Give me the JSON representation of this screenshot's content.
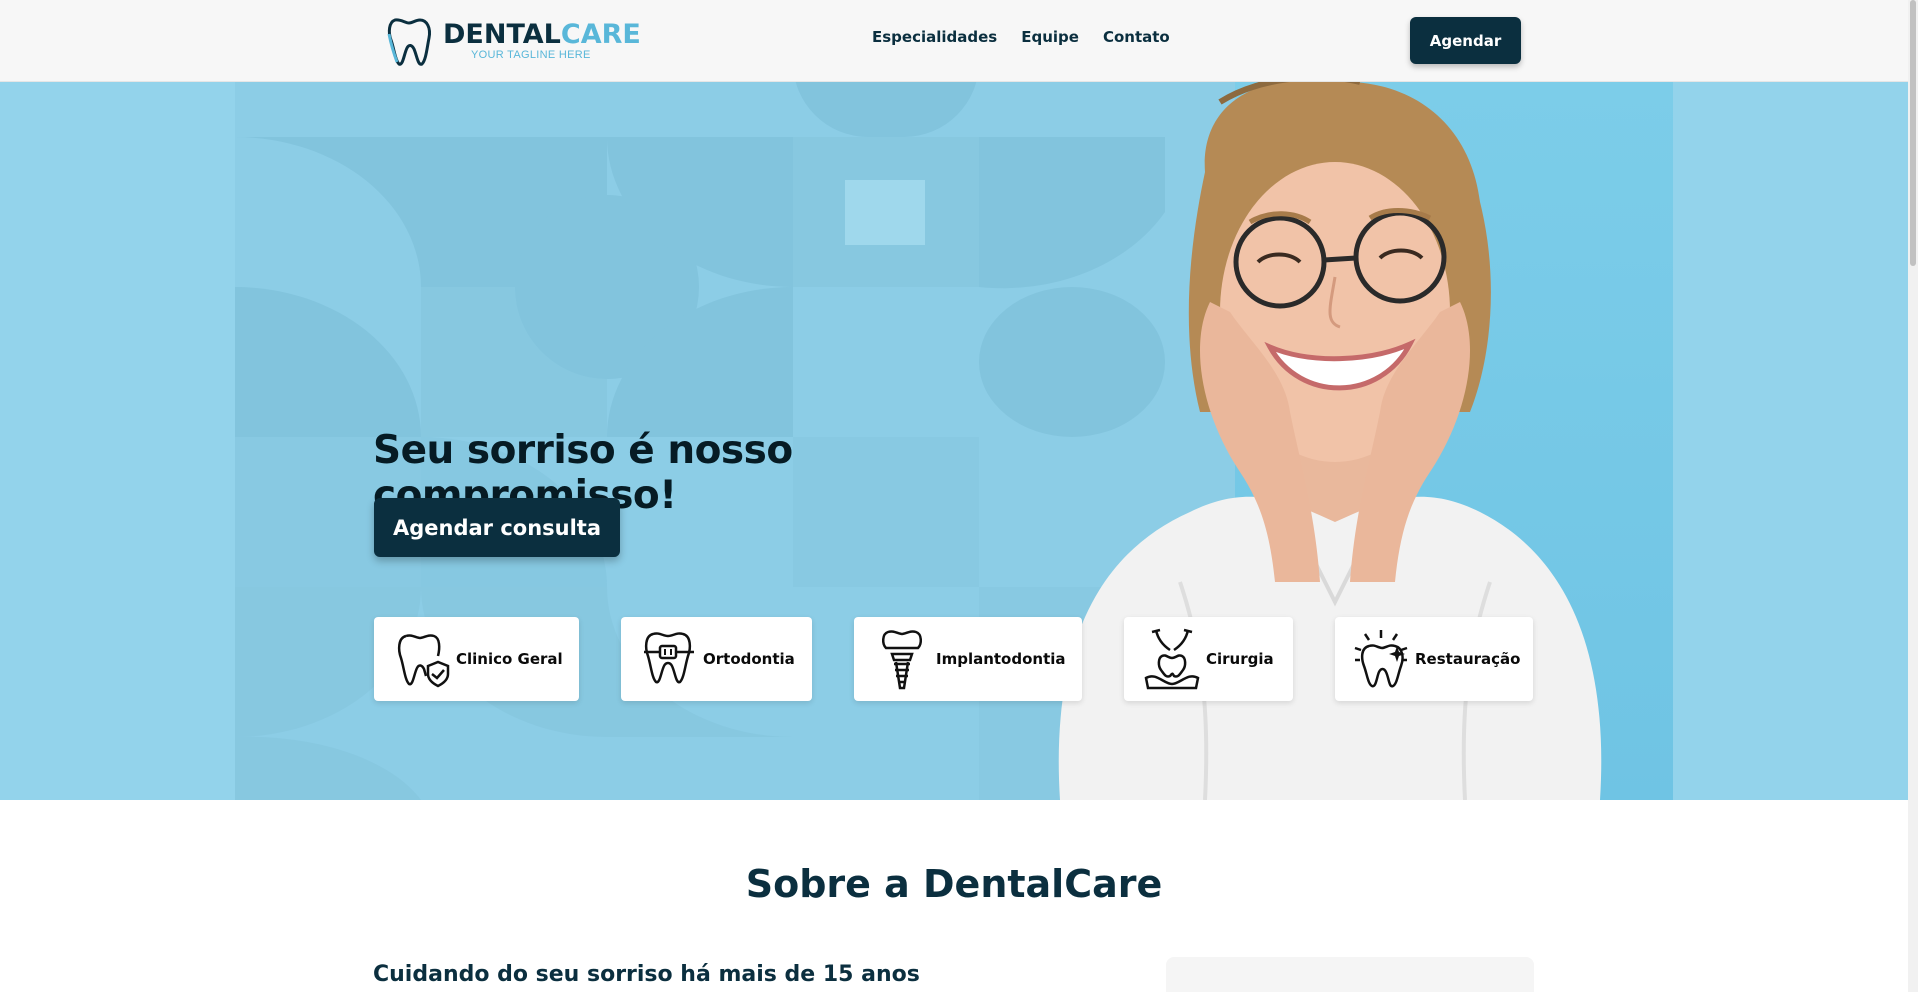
{
  "header": {
    "logo": {
      "name_dark": "DENTAL",
      "name_light": "CARE",
      "tagline": "YOUR TAGLINE HERE"
    },
    "nav": [
      {
        "label": "Especialidades"
      },
      {
        "label": "Equipe"
      },
      {
        "label": "Contato"
      }
    ],
    "cta_label": "Agendar"
  },
  "hero": {
    "title": "Seu sorriso é nosso compromisso!",
    "cta_label": "Agendar consulta",
    "specialties": [
      {
        "label": "Clinico Geral",
        "icon": "tooth-shield-icon"
      },
      {
        "label": "Ortodontia",
        "icon": "tooth-braces-icon"
      },
      {
        "label": "Implantodontia",
        "icon": "dental-implant-icon"
      },
      {
        "label": "Cirurgia",
        "icon": "tooth-extraction-icon"
      },
      {
        "label": "Restauração",
        "icon": "sparkling-tooth-icon"
      }
    ]
  },
  "about": {
    "title": "Sobre a DentalCare",
    "subtitle": "Cuidando do seu sorriso há mais de 15 anos"
  },
  "colors": {
    "primary": "#0b2f3f",
    "accent": "#59b7d9",
    "hero_bg": "#8ccde6"
  }
}
